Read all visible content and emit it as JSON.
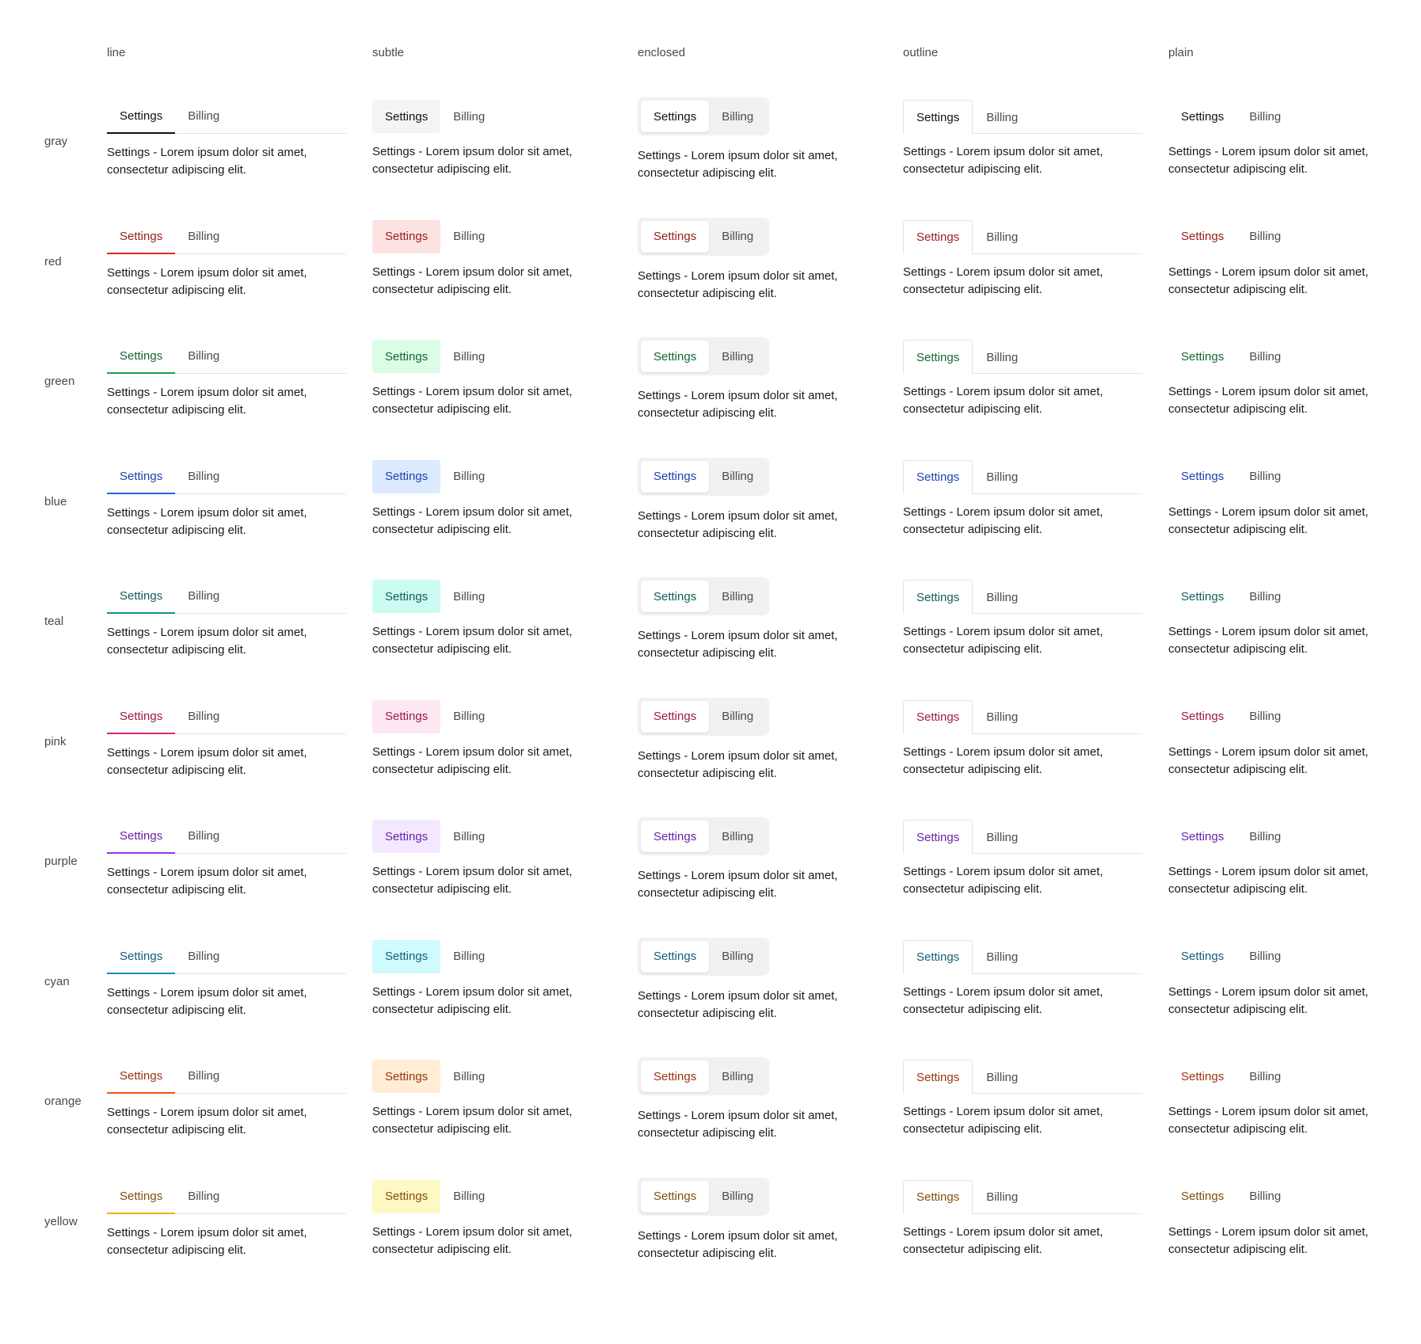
{
  "variants": [
    "line",
    "subtle",
    "enclosed",
    "outline",
    "plain"
  ],
  "rows": [
    {
      "label": "gray",
      "fg": "#111111",
      "bg": "#f4f4f5",
      "accent": "#111111"
    },
    {
      "label": "red",
      "fg": "#991b1b",
      "bg": "#fde2e2",
      "accent": "#dc2626"
    },
    {
      "label": "green",
      "fg": "#166534",
      "bg": "#dcfce7",
      "accent": "#16a34a"
    },
    {
      "label": "blue",
      "fg": "#1e40af",
      "bg": "#dbeafe",
      "accent": "#2563eb"
    },
    {
      "label": "teal",
      "fg": "#115e59",
      "bg": "#ccfbf1",
      "accent": "#0d9488"
    },
    {
      "label": "pink",
      "fg": "#9d174d",
      "bg": "#fce7f3",
      "accent": "#db2777"
    },
    {
      "label": "purple",
      "fg": "#6b21a8",
      "bg": "#f3e8ff",
      "accent": "#9333ea"
    },
    {
      "label": "cyan",
      "fg": "#155e75",
      "bg": "#cffafe",
      "accent": "#0891b2"
    },
    {
      "label": "orange",
      "fg": "#9a3412",
      "bg": "#ffedd5",
      "accent": "#ea580c"
    },
    {
      "label": "yellow",
      "fg": "#854d0e",
      "bg": "#fef9c3",
      "accent": "#eab308"
    }
  ],
  "tabs": [
    "Settings",
    "Billing"
  ],
  "content_text": "Settings - Lorem ipsum dolor sit amet, consectetur adipiscing elit."
}
